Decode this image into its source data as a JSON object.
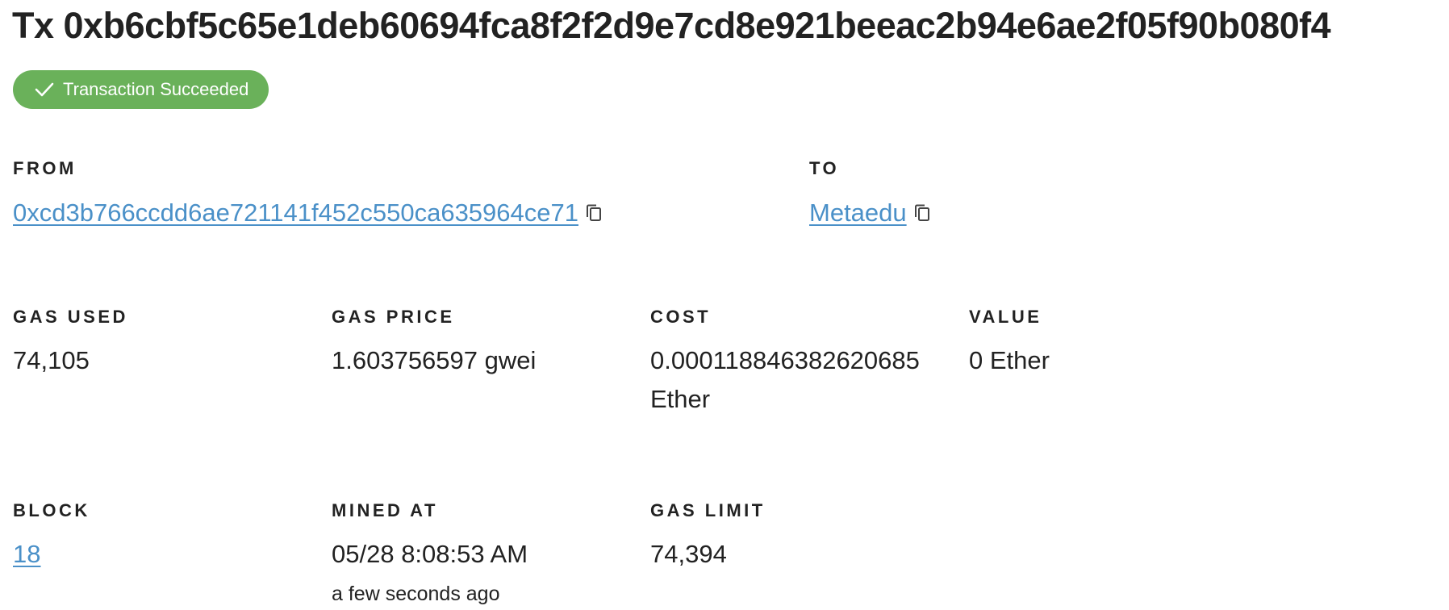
{
  "header": {
    "title": "Tx 0xb6cbf5c65e1deb60694fca8f2f2d9e7cd8e921beeac2b94e6ae2f05f90b080f4"
  },
  "status": {
    "label": "Transaction Succeeded",
    "color": "#6ab15a",
    "icon": "check-icon"
  },
  "parties": {
    "from": {
      "label": "FROM",
      "value": "0xcd3b766ccdd6ae721141f452c550ca635964ce71"
    },
    "to": {
      "label": "TO",
      "value": "Metaedu"
    }
  },
  "gas": {
    "gas_used": {
      "label": "GAS USED",
      "value": "74,105"
    },
    "gas_price": {
      "label": "GAS PRICE",
      "value": "1.603756597 gwei"
    },
    "cost": {
      "label": "COST",
      "value": "0.000118846382620685 Ether"
    },
    "value": {
      "label": "VALUE",
      "value": "0 Ether"
    }
  },
  "block_info": {
    "block": {
      "label": "BLOCK",
      "value": "18"
    },
    "mined_at": {
      "label": "MINED AT",
      "value": "05/28 8:08:53 AM",
      "relative": "a few seconds ago"
    },
    "gas_limit": {
      "label": "GAS LIMIT",
      "value": "74,394"
    }
  },
  "theme": {
    "link_color": "#4a90c8",
    "text_color": "#222222"
  }
}
